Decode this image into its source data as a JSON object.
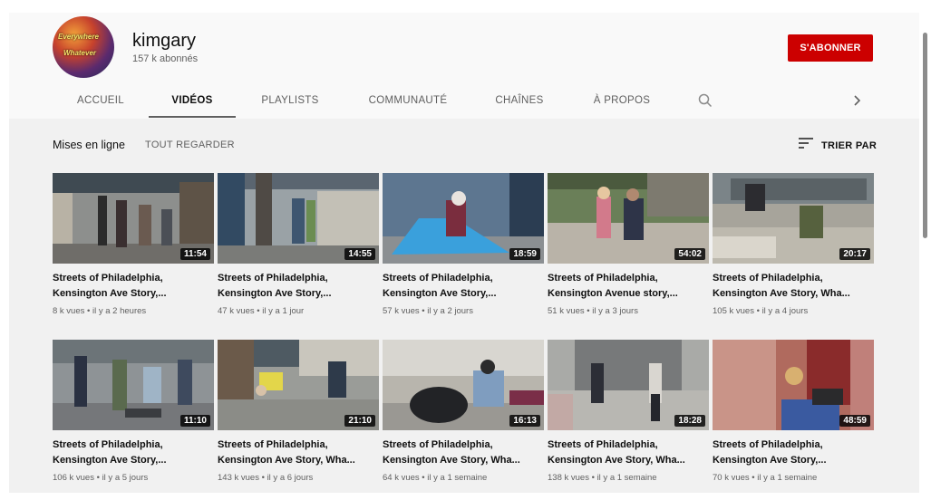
{
  "channel": {
    "avatar_text_1": "Everywhere",
    "avatar_text_2": "Whatever",
    "name": "kimgary",
    "subscribers": "157 k abonnés",
    "subscribe_label": "S'ABONNER"
  },
  "tabs": [
    {
      "label": "ACCUEIL"
    },
    {
      "label": "VIDÉOS"
    },
    {
      "label": "PLAYLISTS"
    },
    {
      "label": "COMMUNAUTÉ"
    },
    {
      "label": "CHAÎNES"
    },
    {
      "label": "À PROPOS"
    }
  ],
  "section": {
    "title": "Mises en ligne",
    "see_all": "TOUT REGARDER",
    "sort_label": "TRIER PAR"
  },
  "videos": [
    {
      "title_line1": "Streets of Philadelphia,",
      "title_line2": "Kensington Ave Story,...",
      "duration": "11:54",
      "views": "8 k vues",
      "age": "il y a 2 heures"
    },
    {
      "title_line1": "Streets of Philadelphia,",
      "title_line2": "Kensington Ave Story,...",
      "duration": "14:55",
      "views": "47 k vues",
      "age": "il y a 1 jour"
    },
    {
      "title_line1": "Streets of Philadelphia,",
      "title_line2": "Kensington Ave Story,...",
      "duration": "18:59",
      "views": "57 k vues",
      "age": "il y a 2 jours"
    },
    {
      "title_line1": "Streets of Philadelphia,",
      "title_line2": "Kensington Avenue story,...",
      "duration": "54:02",
      "views": "51 k vues",
      "age": "il y a 3 jours"
    },
    {
      "title_line1": "Streets of Philadelphia,",
      "title_line2": "Kensington Ave Story, Wha...",
      "duration": "20:17",
      "views": "105 k vues",
      "age": "il y a 4 jours"
    },
    {
      "title_line1": "Streets of Philadelphia,",
      "title_line2": "Kensington Ave Story,...",
      "duration": "11:10",
      "views": "106 k vues",
      "age": "il y a 5 jours"
    },
    {
      "title_line1": "Streets of Philadelphia,",
      "title_line2": "Kensington Ave Story, Wha...",
      "duration": "21:10",
      "views": "143 k vues",
      "age": "il y a 6 jours"
    },
    {
      "title_line1": "Streets of Philadelphia,",
      "title_line2": "Kensington Ave Story, Wha...",
      "duration": "16:13",
      "views": "64 k vues",
      "age": "il y a 1 semaine"
    },
    {
      "title_line1": "Streets of Philadelphia,",
      "title_line2": "Kensington Ave Story, Wha...",
      "duration": "18:28",
      "views": "138 k vues",
      "age": "il y a 1 semaine"
    },
    {
      "title_line1": "Streets of Philadelphia,",
      "title_line2": "Kensington Ave Story,...",
      "duration": "48:59",
      "views": "70 k vues",
      "age": "il y a 1 semaine"
    }
  ],
  "colors": {
    "brand_red": "#cc0000",
    "background": "#f9f9f9",
    "content_background": "#f1f1f1",
    "secondary_text": "#606060"
  },
  "icons": [
    "search-icon",
    "chevron-right-icon",
    "sort-icon"
  ]
}
